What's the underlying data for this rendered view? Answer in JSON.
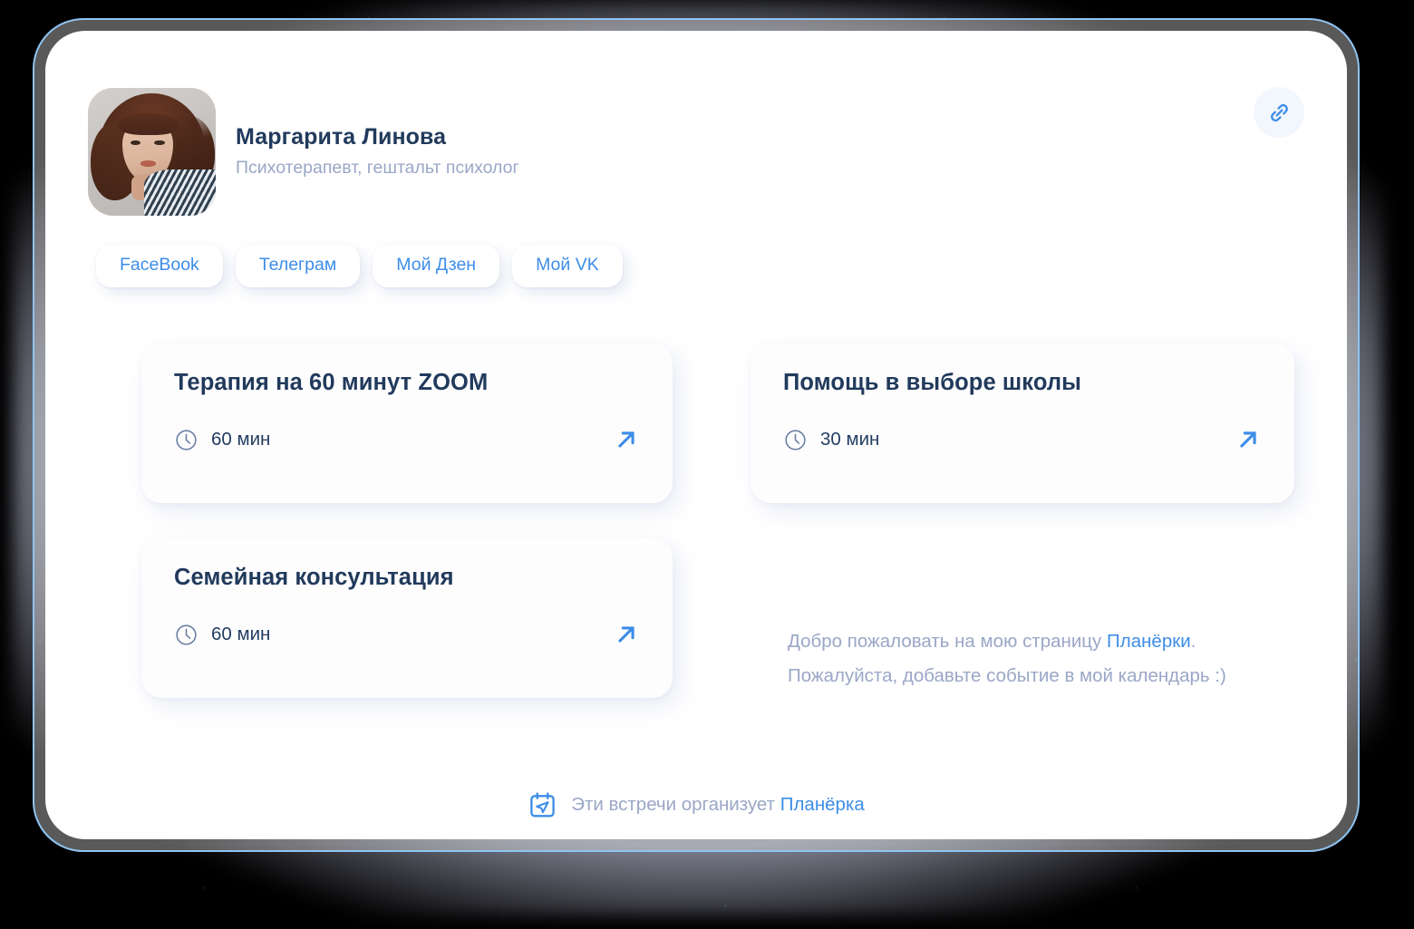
{
  "profile": {
    "name": "Маргарита Линова",
    "role": "Психотерапевт, гештальт психолог",
    "avatar_alt": "portrait-photo"
  },
  "header": {
    "link_button_icon": "link-chain-icon"
  },
  "social_links": [
    {
      "label": "FaceBook"
    },
    {
      "label": "Телеграм"
    },
    {
      "label": "Мой Дзен"
    },
    {
      "label": "Мой VK"
    }
  ],
  "meetings": [
    {
      "title": "Терапия на 60 минут ZOOM",
      "duration": "60 мин",
      "icon": "clock-icon",
      "action_icon": "arrow-up-right-icon"
    },
    {
      "title": "Помощь в выборе школы",
      "duration": "30 мин",
      "icon": "clock-icon",
      "action_icon": "arrow-up-right-icon"
    },
    {
      "title": "Семейная консультация",
      "duration": "60 мин",
      "icon": "clock-icon",
      "action_icon": "arrow-up-right-icon"
    }
  ],
  "welcome": {
    "line1_before": "Добро пожаловать на мою страницу ",
    "line1_link": "Планёрки",
    "line1_after": ".",
    "line2": "Пожалуйста, добавьте событие в мой календарь :)"
  },
  "footer": {
    "icon": "calendar-send-icon",
    "text_before": "Эти встречи организует ",
    "brand": "Планёрка"
  },
  "colors": {
    "accent_blue": "#3D8DE8",
    "title_navy": "#213A5C",
    "muted": "#9AA7C6",
    "frame_border": "#8FC4F2",
    "chip_bg": "#FFFFFF",
    "card_bg": "#FDFDFE",
    "halo": "#D6DBF8"
  }
}
